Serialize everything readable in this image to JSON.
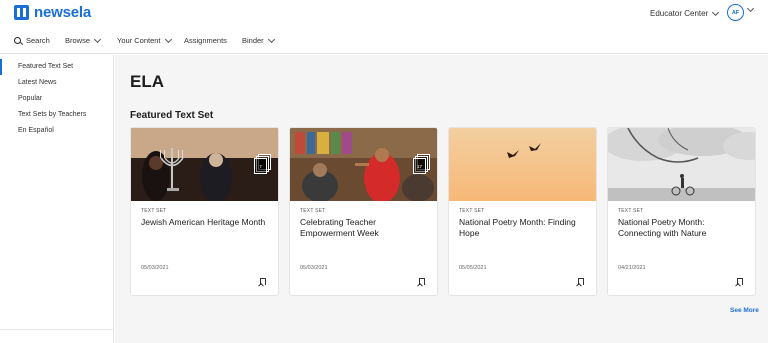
{
  "brand": {
    "name": "newsela",
    "color": "#1a6fd6"
  },
  "header": {
    "educator_center": "Educator Center",
    "avatar_initials": "AF"
  },
  "nav": {
    "search": "Search",
    "browse": "Browse",
    "your_content": "Your Content",
    "assignments": "Assignments",
    "binder": "Binder"
  },
  "sidebar": {
    "items": [
      {
        "label": "Featured Text Set",
        "active": true
      },
      {
        "label": "Latest News"
      },
      {
        "label": "Popular"
      },
      {
        "label": "Text Sets by Teachers"
      },
      {
        "label": "En Español"
      }
    ]
  },
  "main": {
    "title": "ELA",
    "section_title": "Featured Text Set",
    "see_more": "See More",
    "cards": [
      {
        "type": "TEXT SET",
        "title": "Jewish American Heritage Month",
        "date": "05/03/2021",
        "count": "7"
      },
      {
        "type": "TEXT SET",
        "title": "Celebrating Teacher Empowerment Week",
        "date": "05/03/2021",
        "count": "17"
      },
      {
        "type": "TEXT SET",
        "title": "National Poetry Month: Finding Hope",
        "date": "05/05/2021"
      },
      {
        "type": "TEXT SET",
        "title": "National Poetry Month: Connecting with Nature",
        "date": "04/21/2021"
      }
    ]
  }
}
